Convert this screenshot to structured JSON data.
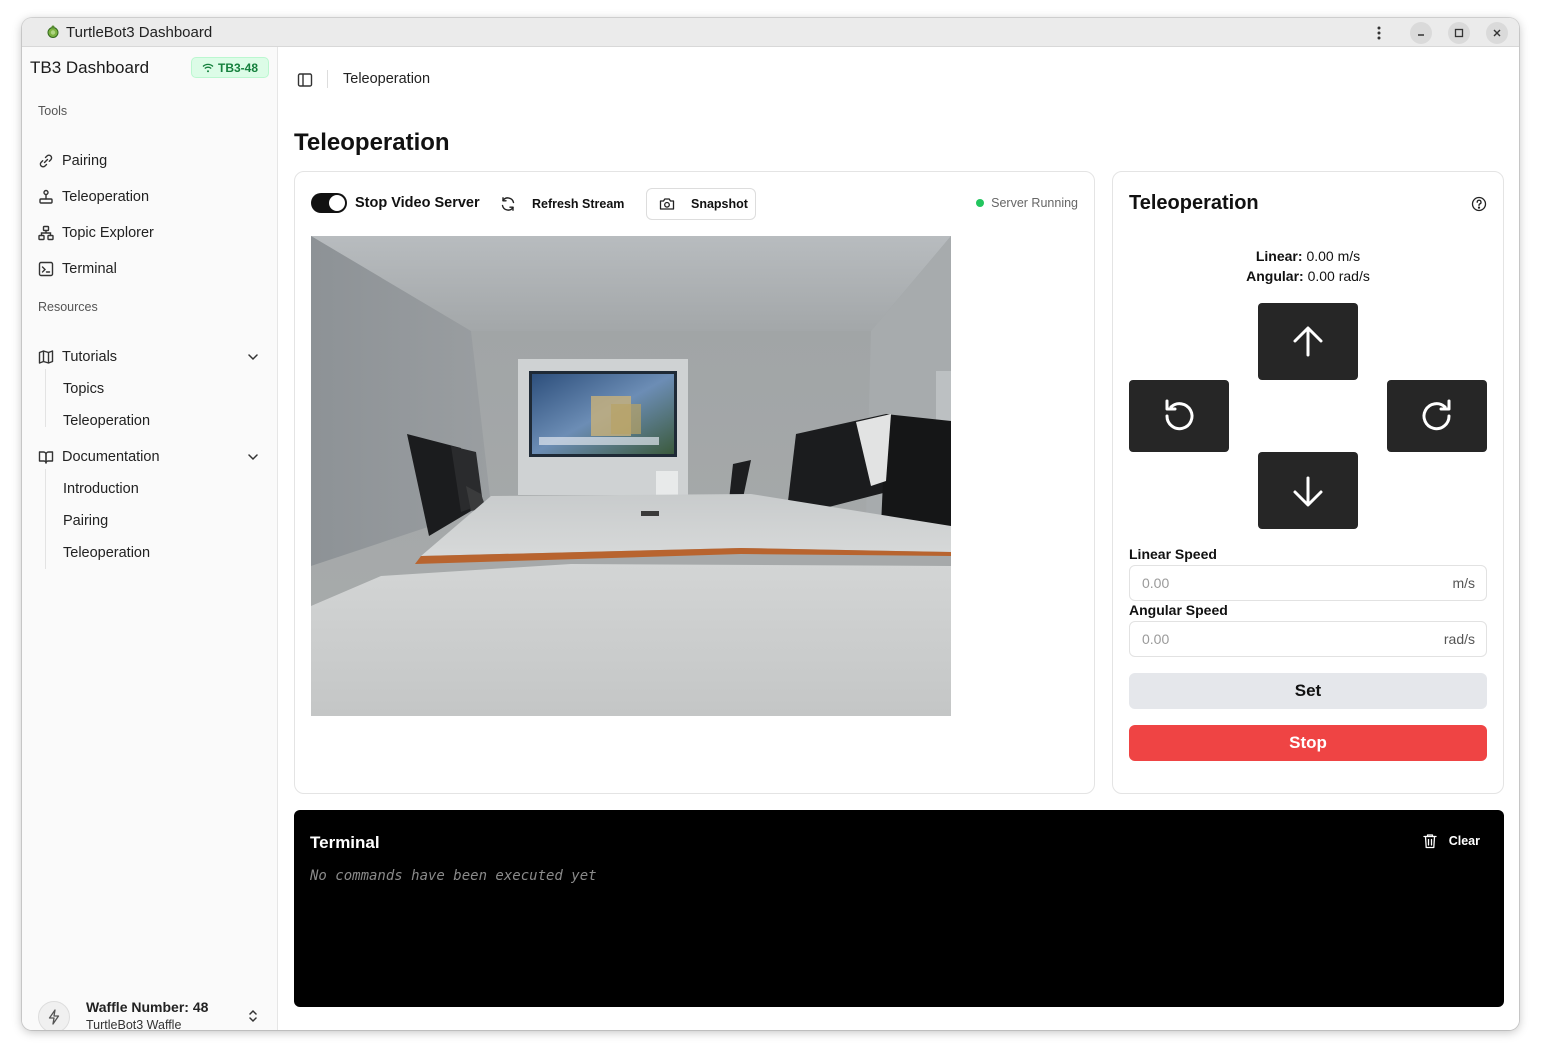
{
  "window": {
    "title": "TurtleBot3 Dashboard"
  },
  "sidebar": {
    "brand": "TB3 Dashboard",
    "badge": "TB3-48",
    "tools_label": "Tools",
    "tools": [
      {
        "label": "Pairing",
        "icon": "link-icon"
      },
      {
        "label": "Teleoperation",
        "icon": "joystick-icon"
      },
      {
        "label": "Topic Explorer",
        "icon": "network-icon"
      },
      {
        "label": "Terminal",
        "icon": "terminal-icon"
      }
    ],
    "resources_label": "Resources",
    "tutorials": {
      "label": "Tutorials",
      "items": [
        "Topics",
        "Teleoperation"
      ]
    },
    "documentation": {
      "label": "Documentation",
      "items": [
        "Introduction",
        "Pairing",
        "Teleoperation"
      ]
    },
    "user": {
      "name": "Waffle Number: 48",
      "model": "TurtleBot3 Waffle"
    }
  },
  "header": {
    "breadcrumb": "Teleoperation"
  },
  "page": {
    "title": "Teleoperation"
  },
  "video": {
    "toggle_label": "Stop Video Server",
    "toggle_on": true,
    "refresh_label": "Refresh Stream",
    "snapshot_label": "Snapshot",
    "status": "Server Running",
    "status_color": "#22c55e"
  },
  "teleop": {
    "title": "Teleoperation",
    "linear_label": "Linear:",
    "linear_value": "0.00 m/s",
    "angular_label": "Angular:",
    "angular_value": "0.00 rad/s",
    "linear_speed_label": "Linear Speed",
    "linear_speed_placeholder": "0.00",
    "linear_speed_unit": "m/s",
    "angular_speed_label": "Angular Speed",
    "angular_speed_placeholder": "0.00",
    "angular_speed_unit": "rad/s",
    "set_label": "Set",
    "stop_label": "Stop",
    "stop_color": "#ef4444"
  },
  "terminal": {
    "title": "Terminal",
    "clear_label": "Clear",
    "empty_message": "No commands have been executed yet"
  }
}
